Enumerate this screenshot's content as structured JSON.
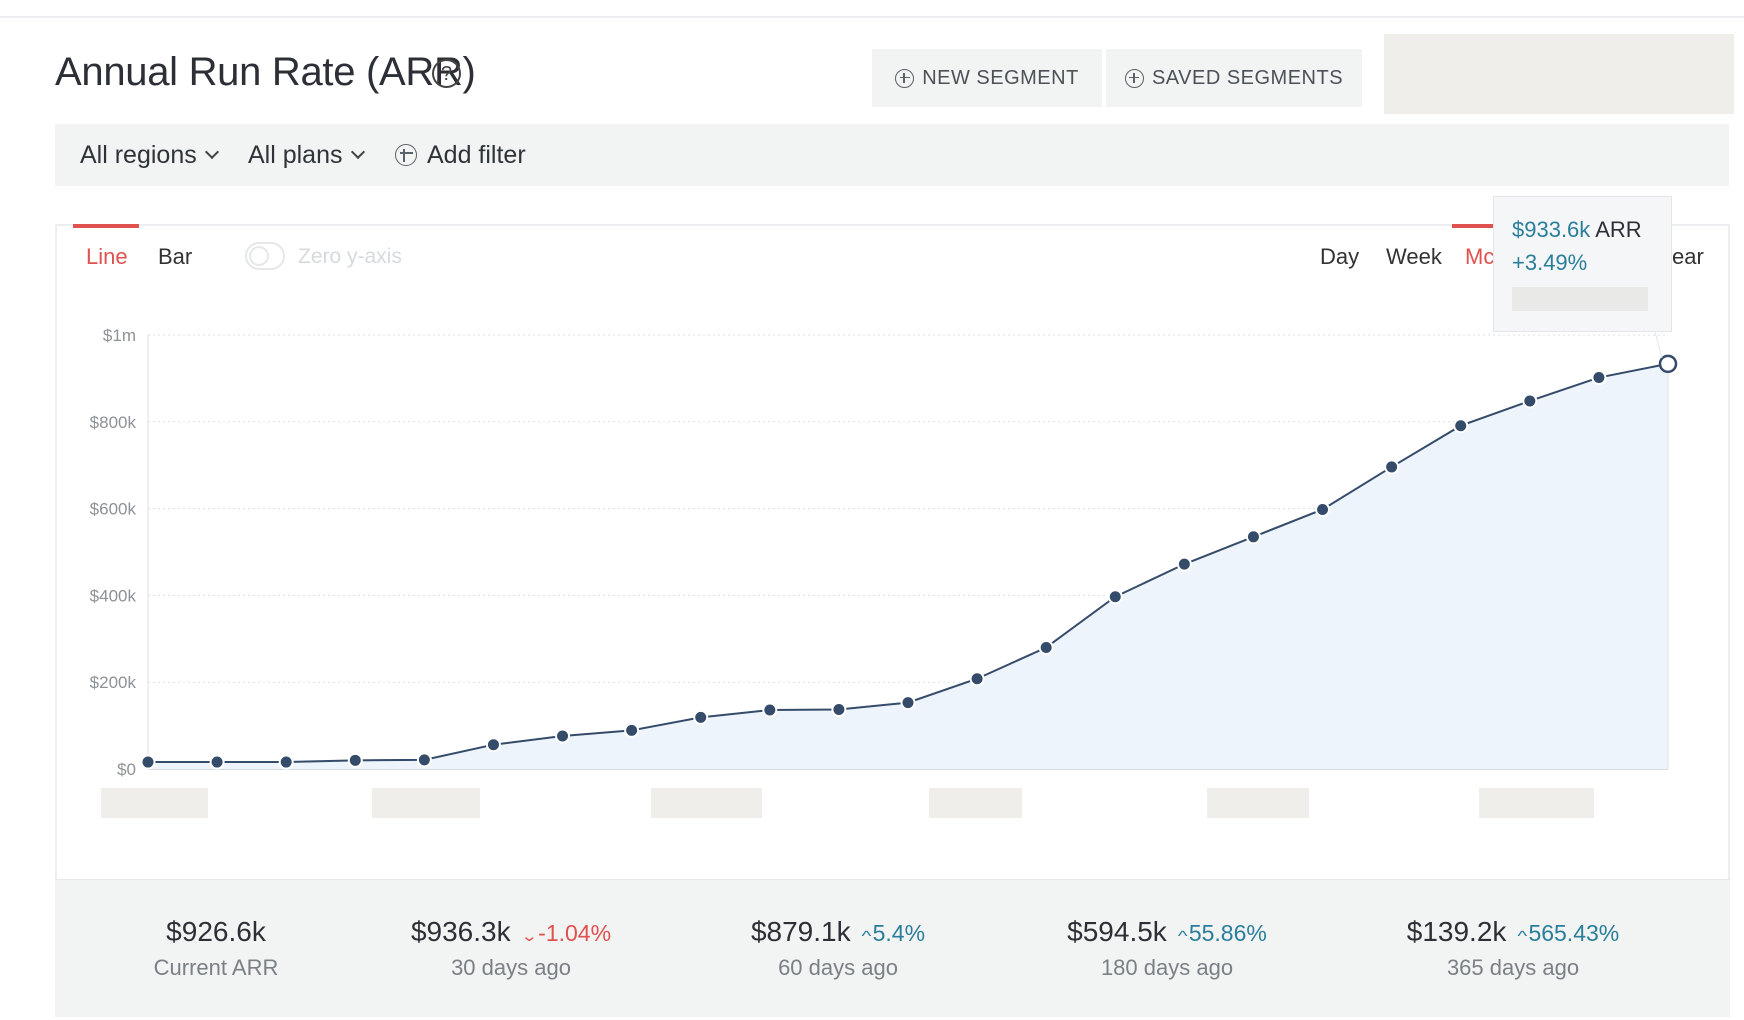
{
  "header": {
    "title": "Annual Run Rate (ARR)",
    "help_glyph": "?",
    "new_segment_label": "NEW SEGMENT",
    "saved_segments_label": "SAVED SEGMENTS"
  },
  "filters": {
    "regions_label": "All regions",
    "plans_label": "All plans",
    "add_filter_label": "Add filter"
  },
  "chart_controls": {
    "chart_types": [
      {
        "label": "Line",
        "active": true
      },
      {
        "label": "Bar",
        "active": false
      }
    ],
    "zero_y_axis_label": "Zero y-axis",
    "zero_y_axis_on": false,
    "intervals": [
      {
        "label": "Day",
        "active": false
      },
      {
        "label": "Week",
        "active": false
      },
      {
        "label": "Mc",
        "active": true
      },
      {
        "label": "ear",
        "active": false
      }
    ]
  },
  "tooltip": {
    "value": "$933.6k",
    "unit": "ARR",
    "change": "+3.49%"
  },
  "chart_data": {
    "type": "area",
    "title": "",
    "xlabel": "",
    "ylabel": "",
    "y_ticks": [
      "$0",
      "$200k",
      "$400k",
      "$600k",
      "$800k",
      "$1m"
    ],
    "ylim": [
      0,
      1000000
    ],
    "grid": true,
    "series": [
      {
        "values": [
          16000,
          16000,
          16000,
          20000,
          21000,
          56000,
          76000,
          89000,
          119000,
          136000,
          137000,
          153000,
          208000,
          280000,
          397000,
          472000,
          535000,
          598000,
          696000,
          791000,
          848000,
          902000,
          933600
        ]
      }
    ],
    "highlighted_point": {
      "index": 22,
      "value": 933600
    },
    "colors": {
      "line": "#354b6a",
      "fill": "#eef4fb",
      "point": "#354b6a"
    }
  },
  "summary": [
    {
      "value": "$926.6k",
      "label": "Current ARR",
      "change": "",
      "direction": ""
    },
    {
      "value": "$936.3k",
      "label": "30 days ago",
      "change": "-1.04%",
      "direction": "down"
    },
    {
      "value": "$879.1k",
      "label": "60 days ago",
      "change": "5.4%",
      "direction": "up"
    },
    {
      "value": "$594.5k",
      "label": "180 days ago",
      "change": "55.86%",
      "direction": "up"
    },
    {
      "value": "$139.2k",
      "label": "365 days ago",
      "change": "565.43%",
      "direction": "up"
    }
  ],
  "colors": {
    "accent_red": "#e0524f",
    "accent_teal": "#2a7e9b"
  }
}
